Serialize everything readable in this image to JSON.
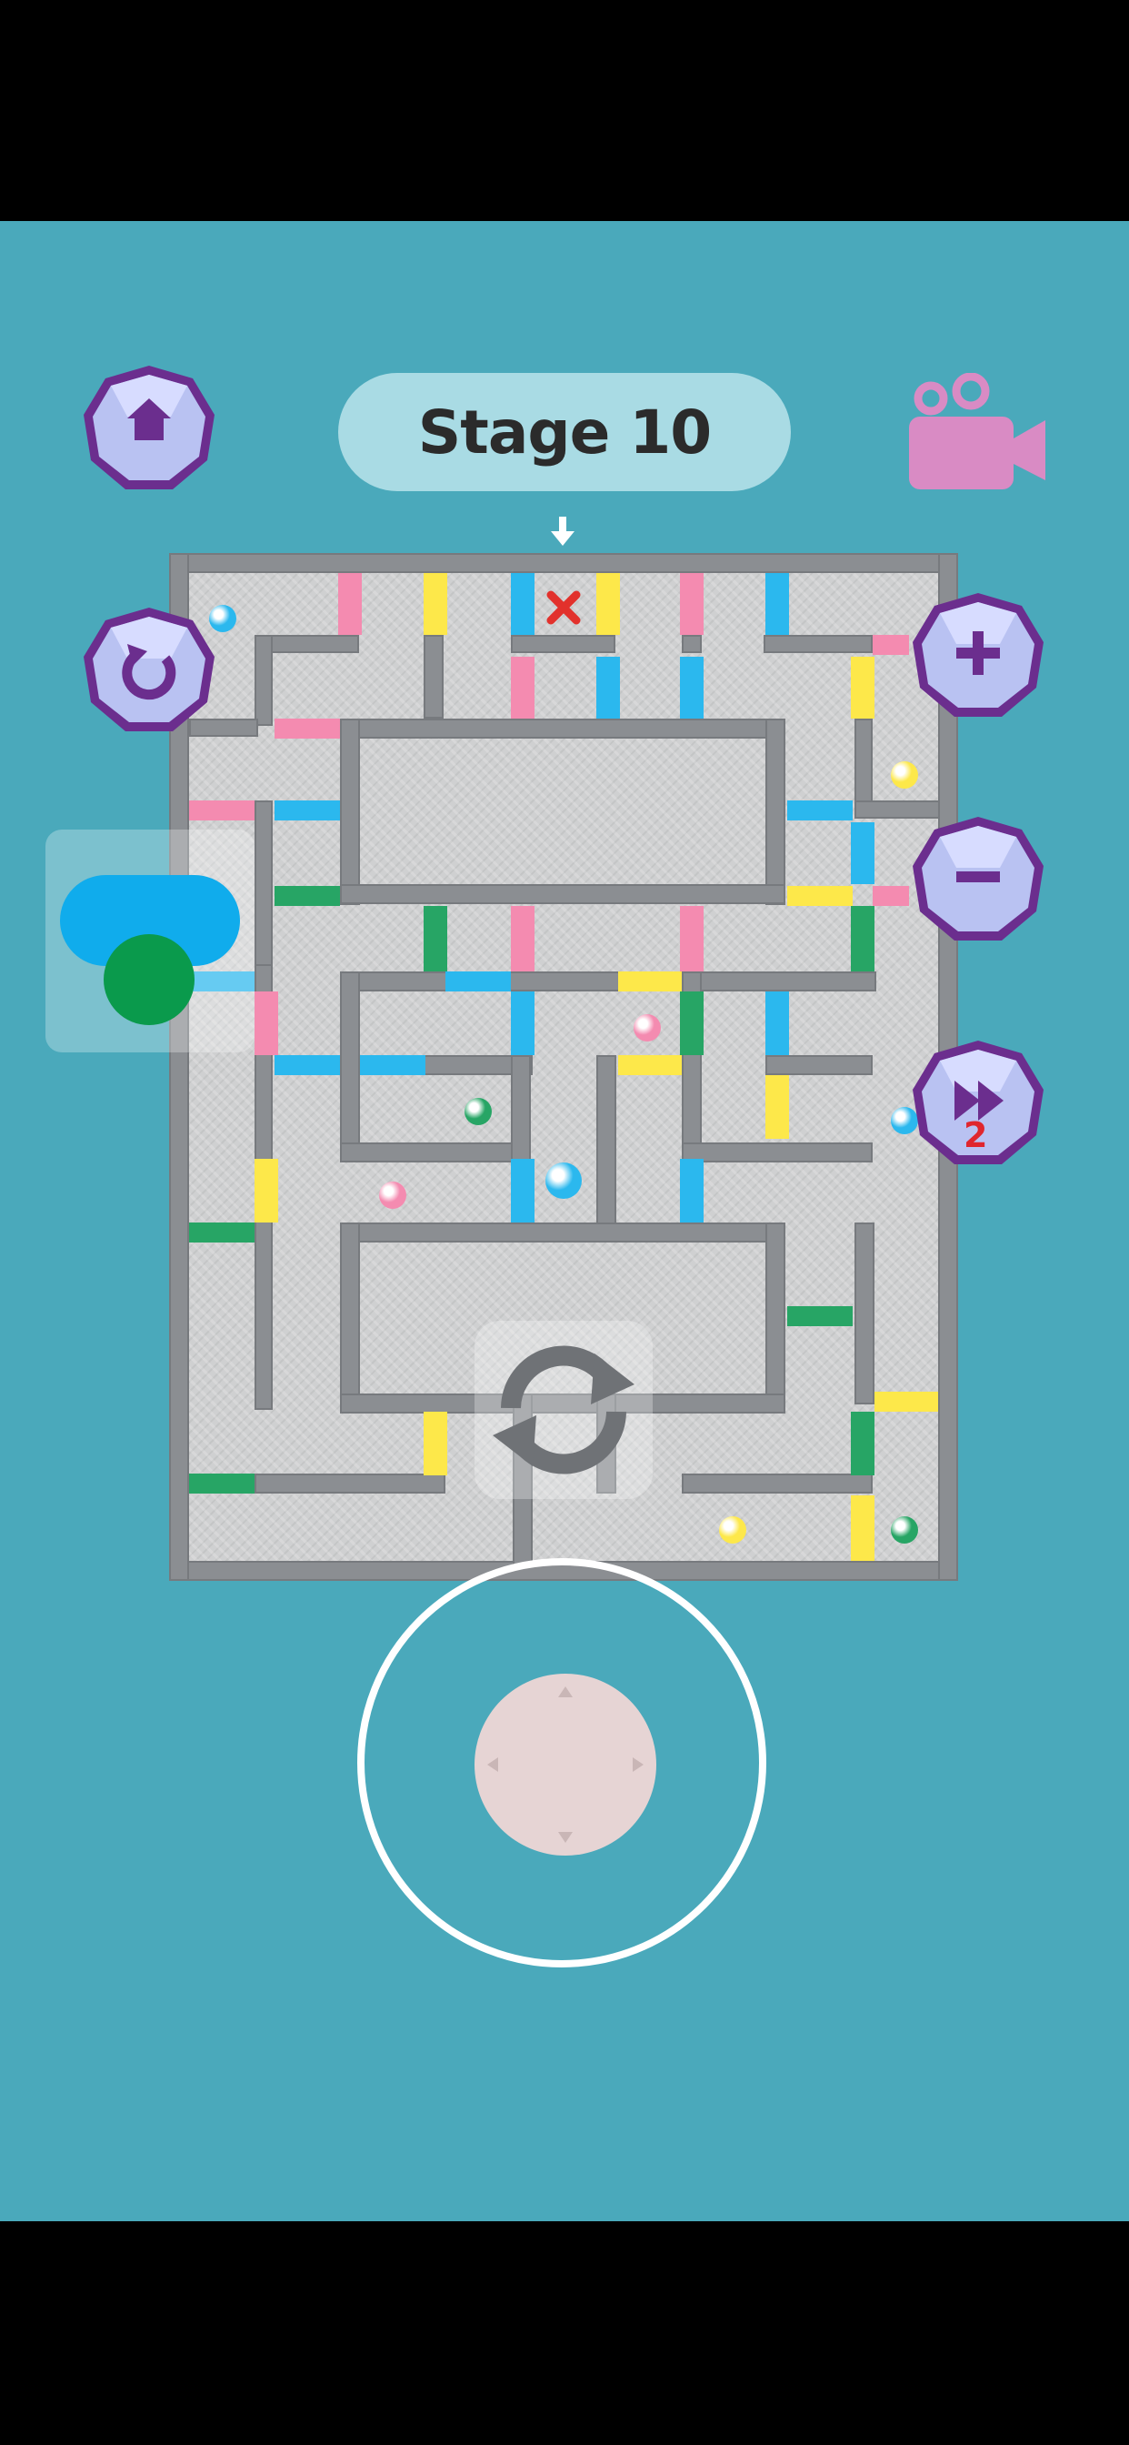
{
  "header": {
    "stage_label": "Stage 10"
  },
  "buttons": {
    "home": {
      "icon": "home-icon"
    },
    "restart": {
      "icon": "restart-icon"
    },
    "zoom_in": {
      "icon": "plus-icon"
    },
    "zoom_out": {
      "icon": "minus-icon"
    },
    "fast_forward": {
      "icon": "fast-forward-icon",
      "badge": "2"
    },
    "camera": {
      "icon": "video-camera-icon"
    },
    "rotate": {
      "icon": "rotate-icon"
    }
  },
  "indicator": {
    "icon": "down-arrow-icon"
  },
  "colors": {
    "background": "#4aa9bb",
    "pink": "#f48bb0",
    "yellow": "#fde84a",
    "blue": "#2bb8ee",
    "green": "#27a565",
    "wall": "#8b8e92",
    "gem_purple": "#6b2e8e",
    "gem_face": "#b9c2f2"
  }
}
